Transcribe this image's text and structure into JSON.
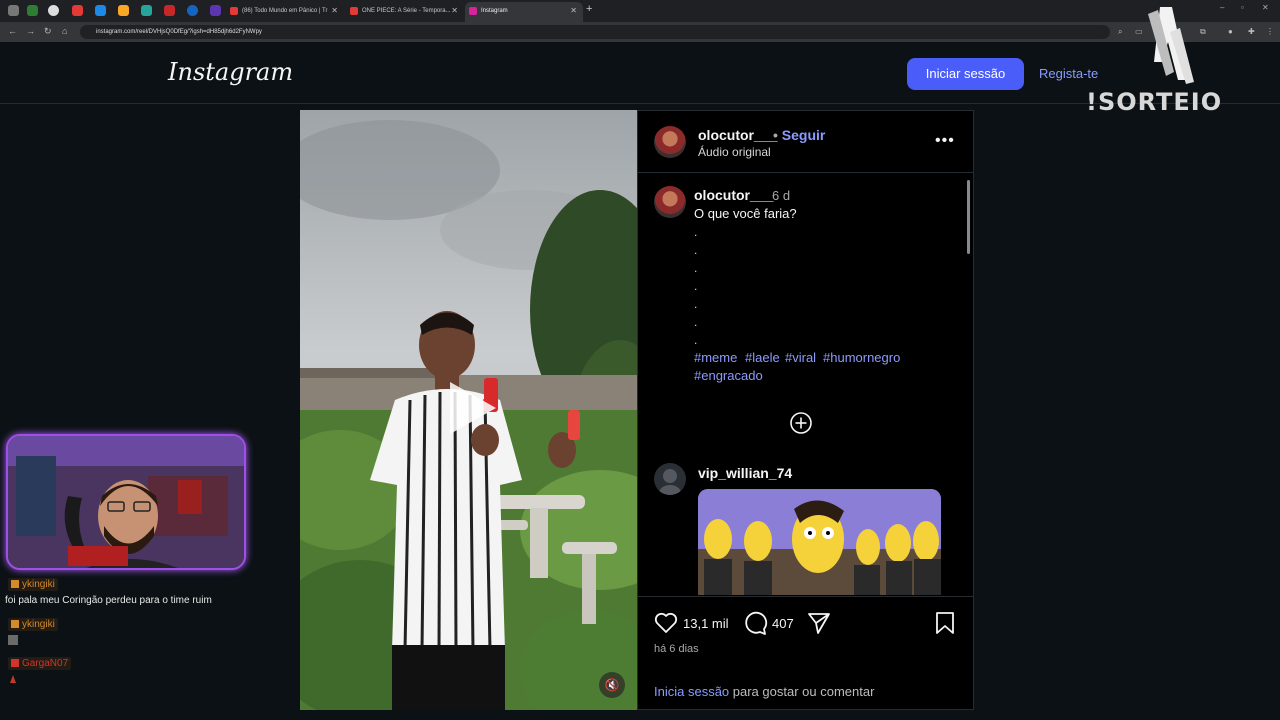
{
  "browser": {
    "tabs": [
      {
        "title": "(86) Todo Mundo em Pânico | Tr",
        "color": "#e53935"
      },
      {
        "title": "ONE PIECE: A Série - Tempora...",
        "color": "#e53935"
      },
      {
        "title": "Instagram",
        "color": "#d6249f"
      }
    ],
    "url": "instagram.com/reel/DVHjsQ0DfEg/?igsh=dH85djh6d2FyNWpy"
  },
  "header": {
    "logo": "Instagram",
    "login_button": "Iniciar sessão",
    "signup_link": "Regista-te"
  },
  "overlay": {
    "sorteio": "!SORTEIO"
  },
  "post": {
    "author": "olocutor___",
    "follow_separator": "•",
    "follow": "Seguir",
    "audio": "Áudio original",
    "caption_author": "olocutor___",
    "caption_time": "6 d",
    "caption": "O que você faria?",
    "dot": ".",
    "hashtags_line1": [
      "#meme",
      "#laele",
      "#viral",
      "#humornegro"
    ],
    "hashtags_line2": [
      "#engracado"
    ],
    "commenter": "vip_willian_74",
    "likes": "13,1 mil",
    "comments": "407",
    "posted": "há 6 dias",
    "login_prompt_link": "Inicia sessão",
    "login_prompt_rest": " para gostar ou comentar"
  },
  "chat": {
    "messages": [
      {
        "user": "ykingiki",
        "text": "foi pala meu Coringão perdeu para o time ruim",
        "user_color": "#d28a2c"
      },
      {
        "user": "ykingiki",
        "text": "",
        "user_color": "#d28a2c"
      },
      {
        "user": "GargaN07",
        "text": "",
        "user_color": "#d0342c"
      }
    ]
  }
}
